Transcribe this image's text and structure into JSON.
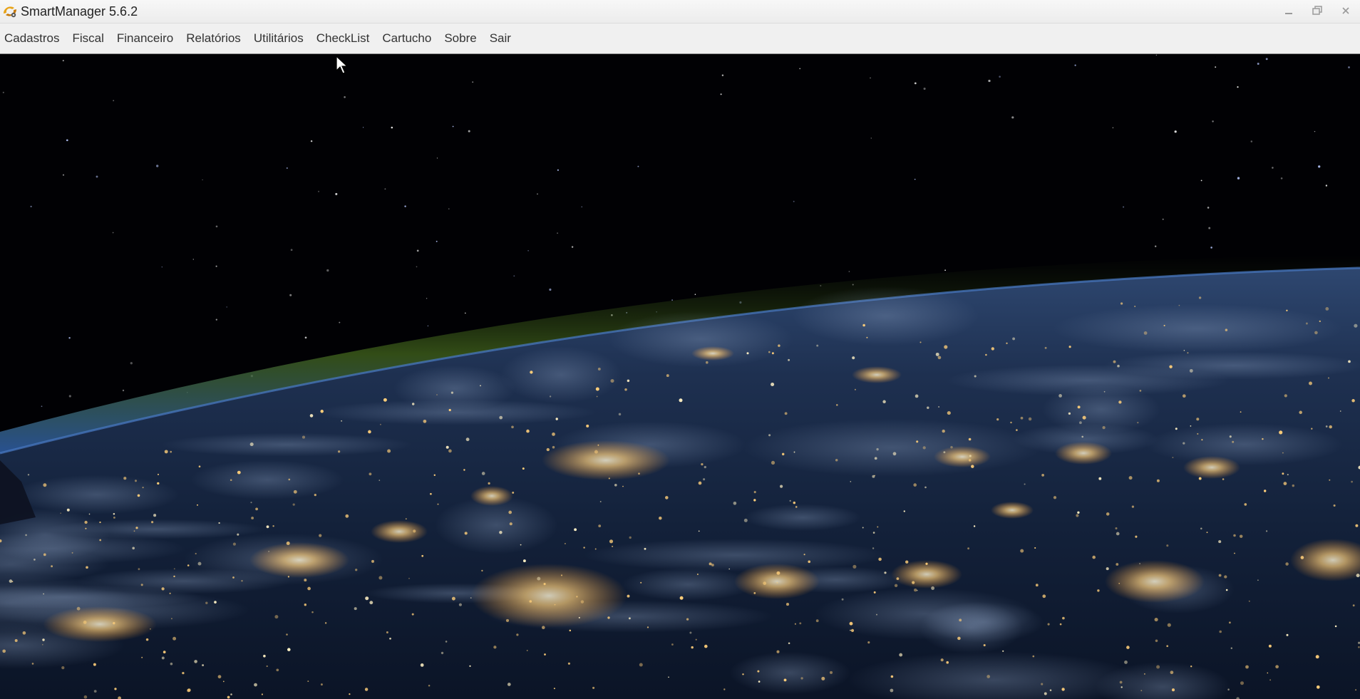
{
  "window": {
    "title": "SmartManager 5.6.2",
    "controls": {
      "minimize_icon": "minimize-icon",
      "maximize_icon": "restore-icon",
      "close_icon": "close-icon"
    }
  },
  "menubar": {
    "items": [
      {
        "label": "Cadastros"
      },
      {
        "label": "Fiscal"
      },
      {
        "label": "Financeiro"
      },
      {
        "label": "Relatórios"
      },
      {
        "label": "Utilitários"
      },
      {
        "label": "CheckList"
      },
      {
        "label": "Cartucho"
      },
      {
        "label": "Sobre"
      },
      {
        "label": "Sair"
      }
    ]
  },
  "background": {
    "description_icon": "earth-night-wallpaper",
    "colors": {
      "space": "#010104",
      "atmosphere": "#3b5a1a",
      "earth": "#1b2a44",
      "city_lights": "#ffcf7a"
    }
  }
}
